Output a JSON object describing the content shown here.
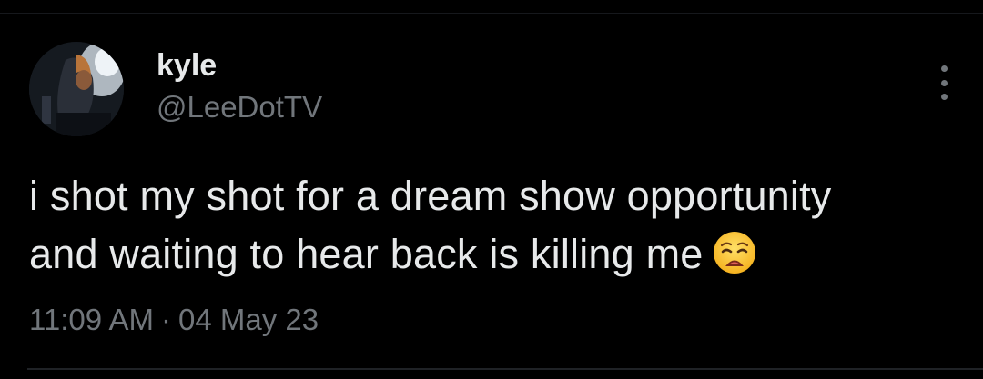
{
  "tweet": {
    "author": {
      "display_name": "kyle",
      "handle": "@LeeDotTV",
      "avatar_icon": "profile-photo"
    },
    "text_lines": [
      "i shot my shot for a dream show opportunity",
      "and waiting to hear back is killing me"
    ],
    "emoji": "weary-face",
    "time": "11:09 AM",
    "separator": "·",
    "date": "04 May 23",
    "more_icon": "vertical-ellipsis"
  },
  "colors": {
    "background": "#000000",
    "primary_text": "#e7e9ea",
    "secondary_text": "#71767b",
    "divider": "#1f2226"
  }
}
